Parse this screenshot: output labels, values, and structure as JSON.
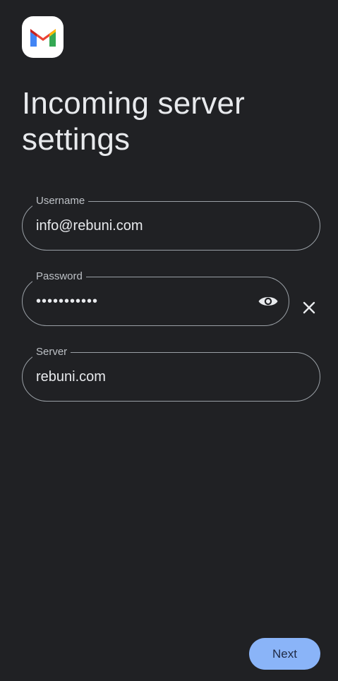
{
  "app": {
    "logo_icon": "gmail-logo-icon"
  },
  "header": {
    "title": "Incoming server settings"
  },
  "form": {
    "username": {
      "label": "Username",
      "value": "info@rebuni.com"
    },
    "password": {
      "label": "Password",
      "value": "•••••••••••",
      "show_icon": "eye-icon",
      "clear_icon": "close-icon"
    },
    "server": {
      "label": "Server",
      "value": "rebuni.com"
    }
  },
  "footer": {
    "next_label": "Next"
  },
  "colors": {
    "background": "#202124",
    "text": "#e8eaed",
    "outline": "#9aa0a6",
    "button": "#8ab4f8"
  }
}
